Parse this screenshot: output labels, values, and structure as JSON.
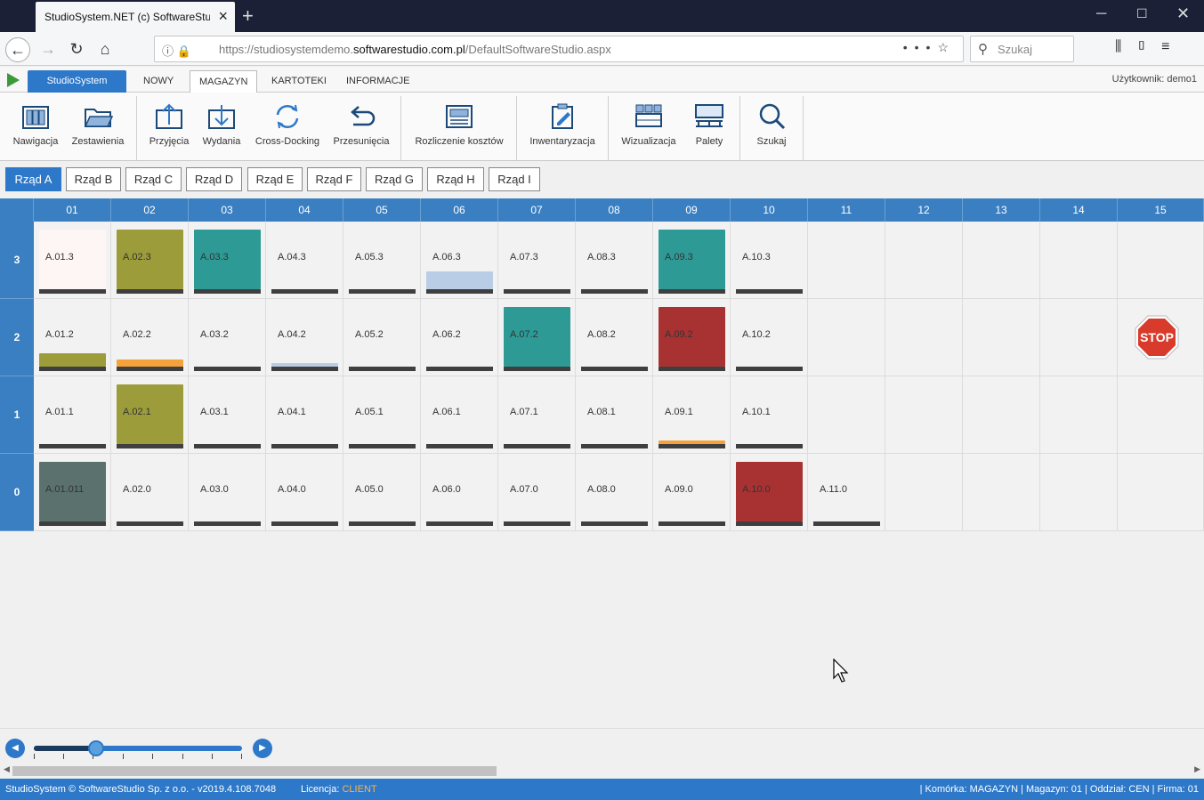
{
  "browser": {
    "tab_title": "StudioSystem.NET (c) SoftwareStudio",
    "url_prefix": "https://studiosystemdemo.",
    "url_domain": "softwarestudio.com.pl",
    "url_path": "/DefaultSoftwareStudio.aspx",
    "search_placeholder": "Szukaj"
  },
  "appmenu": {
    "brand": "StudioSystem",
    "items": [
      "NOWY",
      "MAGAZYN",
      "KARTOTEKI",
      "INFORMACJE"
    ],
    "active": "MAGAZYN",
    "user": "Użytkownik: demo1"
  },
  "ribbon": [
    {
      "label": "Nawigacja",
      "icon": "navigation-icon"
    },
    {
      "label": "Zestawienia",
      "icon": "folder-icon"
    },
    {
      "label": "Przyjęcia",
      "icon": "receipt-icon"
    },
    {
      "label": "Wydania",
      "icon": "issue-icon"
    },
    {
      "label": "Cross-Docking",
      "icon": "cross-docking-icon"
    },
    {
      "label": "Przesunięcia",
      "icon": "transfer-icon"
    },
    {
      "label": "Rozliczenie kosztów",
      "icon": "cost-settlement-icon"
    },
    {
      "label": "Inwentaryzacja",
      "icon": "inventory-icon"
    },
    {
      "label": "Wizualizacja",
      "icon": "visualization-icon"
    },
    {
      "label": "Palety",
      "icon": "pallets-icon"
    },
    {
      "label": "Szukaj",
      "icon": "search-icon"
    }
  ],
  "rows_tabs": [
    "Rząd A",
    "Rząd B",
    "Rząd C",
    "Rząd D",
    "Rząd E",
    "Rząd F",
    "Rząd G",
    "Rząd H",
    "Rząd I"
  ],
  "active_row": "Rząd A",
  "grid": {
    "columns": [
      "01",
      "02",
      "03",
      "04",
      "05",
      "06",
      "07",
      "08",
      "09",
      "10",
      "11",
      "12",
      "13",
      "14",
      "15"
    ],
    "levels": [
      "3",
      "2",
      "1",
      "0"
    ],
    "colors": {
      "olive": "#9c9c3a",
      "teal": "#2e9a96",
      "red": "#a83232",
      "slate": "#5a716e",
      "orange": "#f5a23c",
      "lightblue": "#b9cde6",
      "pale": "#fdf6f4"
    },
    "cells": [
      {
        "level": "3",
        "col": "01",
        "code": "A.01.3",
        "fill": "pale",
        "fill_level": 1.0
      },
      {
        "level": "3",
        "col": "02",
        "code": "A.02.3",
        "fill": "olive",
        "fill_level": 1.0
      },
      {
        "level": "3",
        "col": "03",
        "code": "A.03.3",
        "fill": "teal",
        "fill_level": 1.0
      },
      {
        "level": "3",
        "col": "04",
        "code": "A.04.3"
      },
      {
        "level": "3",
        "col": "05",
        "code": "A.05.3"
      },
      {
        "level": "3",
        "col": "06",
        "code": "A.06.3",
        "fill": "lightblue",
        "fill_level": 0.3
      },
      {
        "level": "3",
        "col": "07",
        "code": "A.07.3"
      },
      {
        "level": "3",
        "col": "08",
        "code": "A.08.3"
      },
      {
        "level": "3",
        "col": "09",
        "code": "A.09.3",
        "fill": "teal",
        "fill_level": 1.0
      },
      {
        "level": "3",
        "col": "10",
        "code": "A.10.3"
      },
      {
        "level": "2",
        "col": "01",
        "code": "A.01.2",
        "fill": "olive",
        "fill_level": 0.22
      },
      {
        "level": "2",
        "col": "02",
        "code": "A.02.2",
        "fill": "orange",
        "fill_level": 0.12
      },
      {
        "level": "2",
        "col": "03",
        "code": "A.03.2"
      },
      {
        "level": "2",
        "col": "04",
        "code": "A.04.2",
        "fill": "lightblue",
        "fill_level": 0.05
      },
      {
        "level": "2",
        "col": "05",
        "code": "A.05.2"
      },
      {
        "level": "2",
        "col": "06",
        "code": "A.06.2"
      },
      {
        "level": "2",
        "col": "07",
        "code": "A.07.2",
        "fill": "teal",
        "fill_level": 1.0
      },
      {
        "level": "2",
        "col": "08",
        "code": "A.08.2"
      },
      {
        "level": "2",
        "col": "09",
        "code": "A.09.2",
        "fill": "red",
        "fill_level": 1.0
      },
      {
        "level": "2",
        "col": "10",
        "code": "A.10.2"
      },
      {
        "level": "1",
        "col": "01",
        "code": "A.01.1"
      },
      {
        "level": "1",
        "col": "02",
        "code": "A.02.1",
        "fill": "olive",
        "fill_level": 1.0
      },
      {
        "level": "1",
        "col": "03",
        "code": "A.03.1"
      },
      {
        "level": "1",
        "col": "04",
        "code": "A.04.1"
      },
      {
        "level": "1",
        "col": "05",
        "code": "A.05.1"
      },
      {
        "level": "1",
        "col": "06",
        "code": "A.06.1"
      },
      {
        "level": "1",
        "col": "07",
        "code": "A.07.1"
      },
      {
        "level": "1",
        "col": "08",
        "code": "A.08.1"
      },
      {
        "level": "1",
        "col": "09",
        "code": "A.09.1",
        "fill": "orange",
        "fill_level": 0.05
      },
      {
        "level": "1",
        "col": "10",
        "code": "A.10.1"
      },
      {
        "level": "0",
        "col": "01",
        "code": "A.01.011",
        "fill": "slate",
        "fill_level": 1.0
      },
      {
        "level": "0",
        "col": "02",
        "code": "A.02.0"
      },
      {
        "level": "0",
        "col": "03",
        "code": "A.03.0"
      },
      {
        "level": "0",
        "col": "04",
        "code": "A.04.0"
      },
      {
        "level": "0",
        "col": "05",
        "code": "A.05.0"
      },
      {
        "level": "0",
        "col": "06",
        "code": "A.06.0"
      },
      {
        "level": "0",
        "col": "07",
        "code": "A.07.0"
      },
      {
        "level": "0",
        "col": "08",
        "code": "A.08.0"
      },
      {
        "level": "0",
        "col": "09",
        "code": "A.09.0"
      },
      {
        "level": "0",
        "col": "10",
        "code": "A.10.0",
        "fill": "red",
        "fill_level": 1.0
      },
      {
        "level": "0",
        "col": "11",
        "code": "A.11.0"
      }
    ],
    "stop_sign": {
      "level": "2",
      "col": "15",
      "text": "STOP"
    }
  },
  "slider": {
    "value": 0.3
  },
  "status": {
    "left": "StudioSystem © SoftwareStudio Sp. z o.o. - v2019.4.108.7048",
    "license_label": "Licencja:",
    "license_value": "CLIENT",
    "right": "| Komórka: MAGAZYN | Magazyn: 01 | Oddział: CEN | Firma: 01"
  }
}
